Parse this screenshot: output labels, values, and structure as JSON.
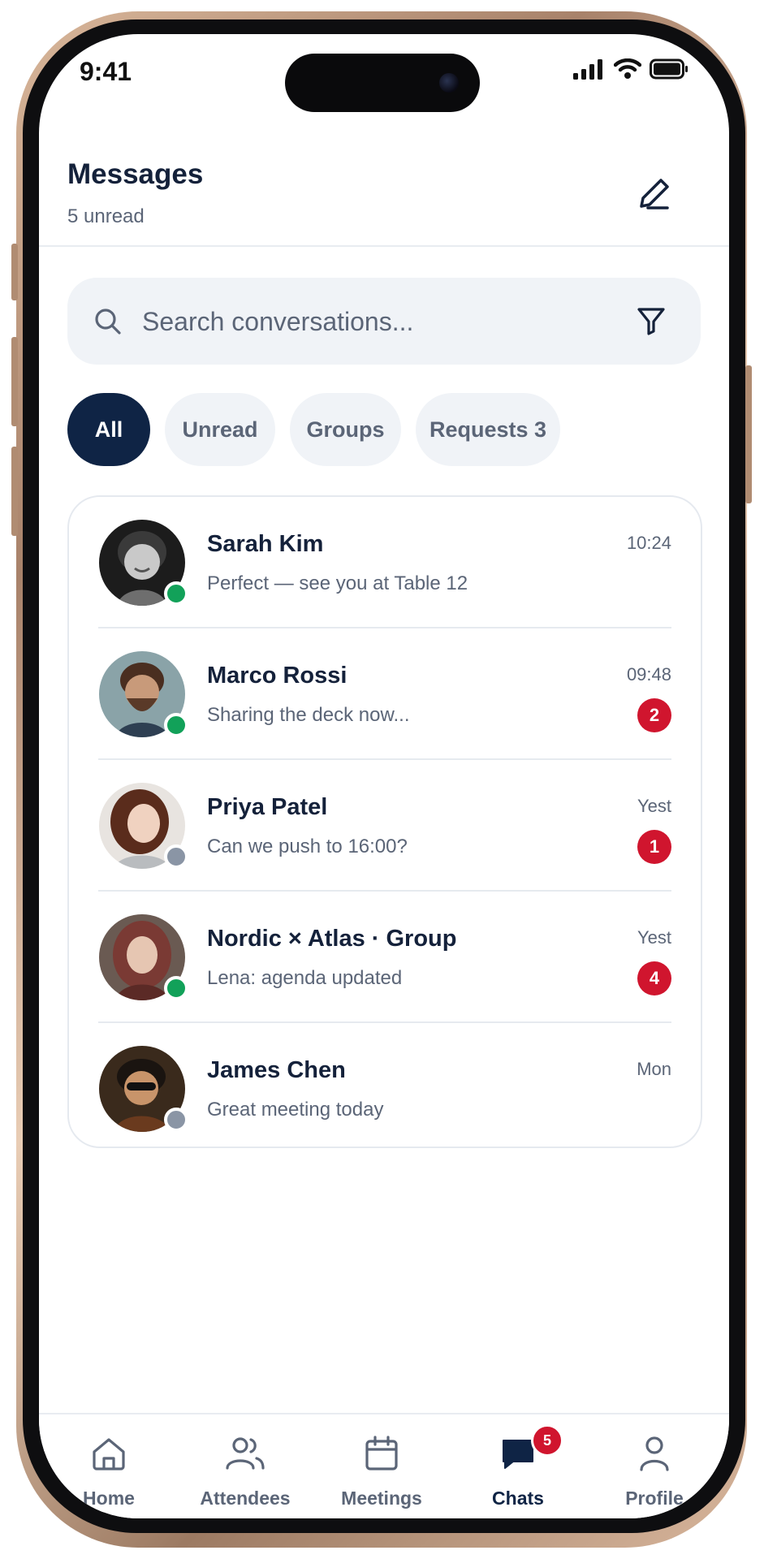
{
  "status_bar": {
    "time": "9:41"
  },
  "header": {
    "title": "Messages",
    "subtitle": "5 unread",
    "compose_icon": "pencil-icon"
  },
  "search": {
    "placeholder": "Search conversations...",
    "value": ""
  },
  "filters": [
    {
      "label": "All",
      "active": true
    },
    {
      "label": "Unread",
      "active": false
    },
    {
      "label": "Groups",
      "active": false
    },
    {
      "label": "Requests 3",
      "active": false
    }
  ],
  "conversations": [
    {
      "name": "Sarah Kim",
      "preview": "Perfect — see you at Table 12",
      "time": "10:24",
      "unread": "",
      "online": true
    },
    {
      "name": "Marco Rossi",
      "preview": "Sharing the deck now...",
      "time": "09:48",
      "unread": "2",
      "online": true
    },
    {
      "name": "Priya Patel",
      "preview": "Can we push to 16:00?",
      "time": "Yest",
      "unread": "1",
      "online": false
    },
    {
      "name": "Nordic × Atlas · Group",
      "preview": "Lena: agenda updated",
      "time": "Yest",
      "unread": "4",
      "online": true
    },
    {
      "name": "James Chen",
      "preview": "Great meeting today",
      "time": "Mon",
      "unread": "",
      "online": false
    }
  ],
  "nav": [
    {
      "label": "Home",
      "icon": "home-icon",
      "active": false
    },
    {
      "label": "Attendees",
      "icon": "users-icon",
      "active": false
    },
    {
      "label": "Meetings",
      "icon": "calendar-icon",
      "active": false
    },
    {
      "label": "Chats",
      "icon": "chat-icon",
      "active": true,
      "badge": "5"
    },
    {
      "label": "Profile",
      "icon": "person-icon",
      "active": false
    }
  ],
  "colors": {
    "navy": "#0f2445",
    "online": "#12a159",
    "offline": "#8a95a5",
    "badge": "#d0152e"
  }
}
